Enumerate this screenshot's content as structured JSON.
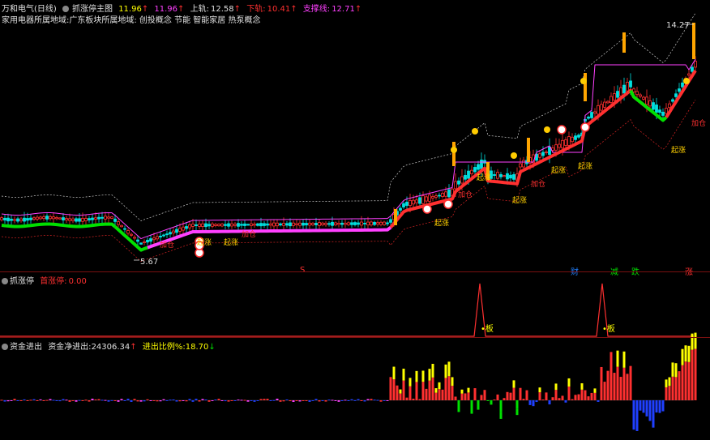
{
  "main": {
    "stock_name": "万和电气(日线)",
    "indicator_name": "抓涨停主图",
    "v1": "11.96",
    "v2": "11.96",
    "line_top_label": "上轨:",
    "line_top_value": "12.58",
    "line_low_label": "下轨:",
    "line_low_value": "10.41",
    "support_label": "支撑线:",
    "support_value": "12.71",
    "sector_line": "家用电器所属地域:广东板块所属地域: 创投概念 节能 智能家居 热泵概念",
    "high_mark": "14.27",
    "low_mark": "5.67"
  },
  "chart_labels": {
    "qizhang": "起涨",
    "jiacang": "加仓",
    "buy_cross": "+"
  },
  "bottom_tags": [
    "S",
    "财",
    "减",
    "跌",
    "涨"
  ],
  "panel2": {
    "name": "抓涨停",
    "label": "首涨停:",
    "value": "0.00",
    "board": "板"
  },
  "panel3": {
    "name": "资金进出",
    "net_label": "资金净进出:",
    "net_value": "24306.34",
    "ratio_label": "进出比例%:",
    "ratio_value": "18.70"
  },
  "colors": {
    "up": "#ff3030",
    "down": "#00e0e0",
    "green": "#00e000",
    "yellow": "#ffff00",
    "magenta": "#ff40ff",
    "blue": "#2040ff"
  }
}
